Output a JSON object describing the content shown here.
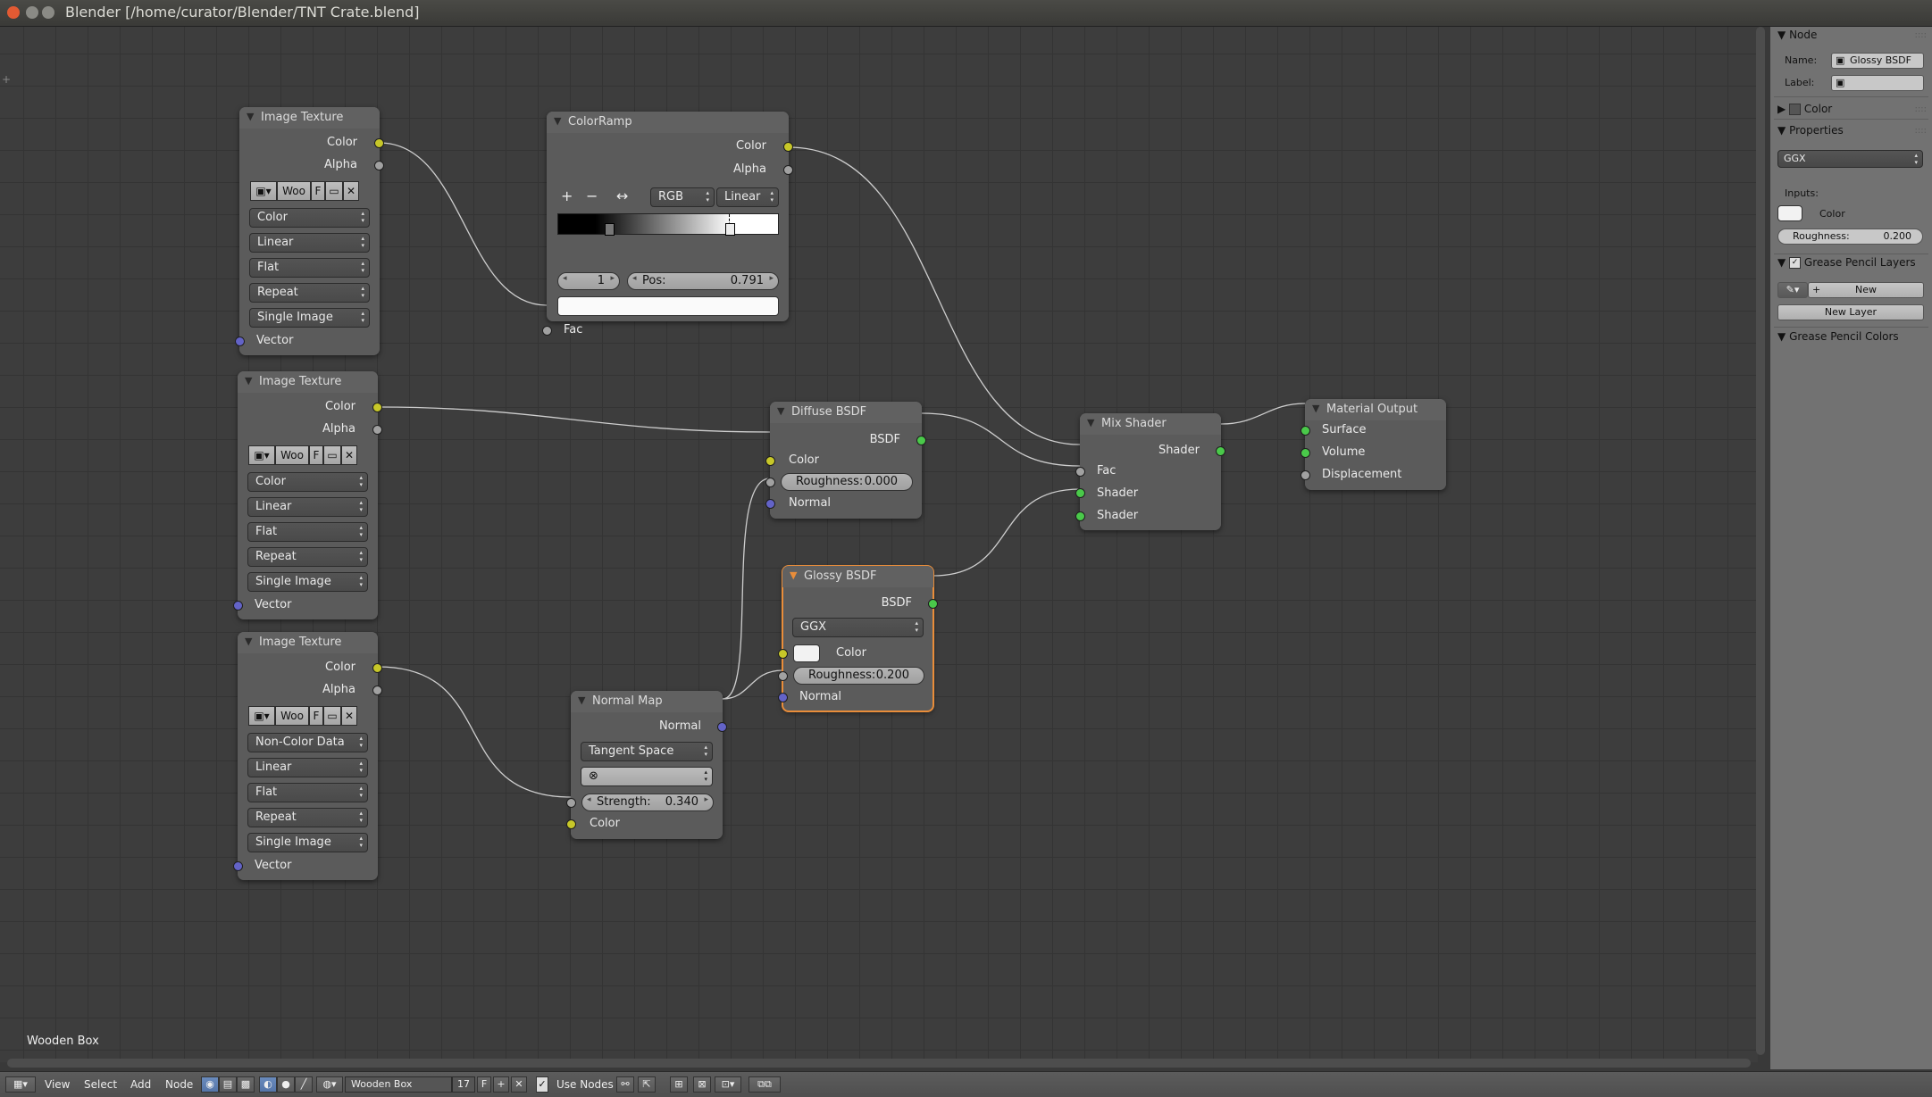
{
  "window": {
    "title": "Blender [/home/curator/Blender/TNT Crate.blend]"
  },
  "editor": {
    "material_label": "Wooden Box"
  },
  "nodes": {
    "tex1": {
      "title": "Image Texture",
      "out_color": "Color",
      "out_alpha": "Alpha",
      "image": "Woo",
      "f": "F",
      "color_space": "Color",
      "interpolation": "Linear",
      "projection": "Flat",
      "extension": "Repeat",
      "source": "Single Image",
      "in_vector": "Vector"
    },
    "tex2": {
      "title": "Image Texture",
      "out_color": "Color",
      "out_alpha": "Alpha",
      "image": "Woo",
      "f": "F",
      "color_space": "Color",
      "interpolation": "Linear",
      "projection": "Flat",
      "extension": "Repeat",
      "source": "Single Image",
      "in_vector": "Vector"
    },
    "tex3": {
      "title": "Image Texture",
      "out_color": "Color",
      "out_alpha": "Alpha",
      "image": "Woo",
      "f": "F",
      "color_space": "Non-Color Data",
      "interpolation": "Linear",
      "projection": "Flat",
      "extension": "Repeat",
      "source": "Single Image",
      "in_vector": "Vector"
    },
    "ramp": {
      "title": "ColorRamp",
      "out_color": "Color",
      "out_alpha": "Alpha",
      "mode": "RGB",
      "interpolation": "Linear",
      "index": "1",
      "pos_label": "Pos:",
      "pos_value": "0.791",
      "in_fac": "Fac",
      "add": "+",
      "remove": "−",
      "flip": "↔"
    },
    "diffuse": {
      "title": "Diffuse BSDF",
      "out": "BSDF",
      "in_color": "Color",
      "roughness_label": "Roughness:",
      "roughness_value": "0.000",
      "in_normal": "Normal"
    },
    "glossy": {
      "title": "Glossy BSDF",
      "out": "BSDF",
      "distribution": "GGX",
      "in_color": "Color",
      "roughness_label": "Roughness:",
      "roughness_value": "0.200",
      "in_normal": "Normal"
    },
    "normalmap": {
      "title": "Normal Map",
      "out": "Normal",
      "space": "Tangent Space",
      "strength_label": "Strength:",
      "strength_value": "0.340",
      "in_color": "Color"
    },
    "mix": {
      "title": "Mix Shader",
      "out": "Shader",
      "in_fac": "Fac",
      "in_shader1": "Shader",
      "in_shader2": "Shader"
    },
    "output": {
      "title": "Material Output",
      "in_surface": "Surface",
      "in_volume": "Volume",
      "in_displacement": "Displacement"
    }
  },
  "sidebar": {
    "node_header": "Node",
    "name_label": "Name:",
    "name_value": "Glossy BSDF",
    "label_label": "Label:",
    "label_value": "",
    "color_header": "Color",
    "properties_header": "Properties",
    "distribution": "GGX",
    "inputs_label": "Inputs:",
    "color_label": "Color",
    "roughness_label": "Roughness:",
    "roughness_value": "0.200",
    "gp_layers_header": "Grease Pencil Layers",
    "new_button": "New",
    "new_layer_button": "New Layer",
    "gp_colors_header": "Grease Pencil Colors"
  },
  "bottombar": {
    "menu_view": "View",
    "menu_select": "Select",
    "menu_add": "Add",
    "menu_node": "Node",
    "material_name": "Wooden Box",
    "users": "17",
    "fake": "F",
    "use_nodes": "Use Nodes"
  }
}
